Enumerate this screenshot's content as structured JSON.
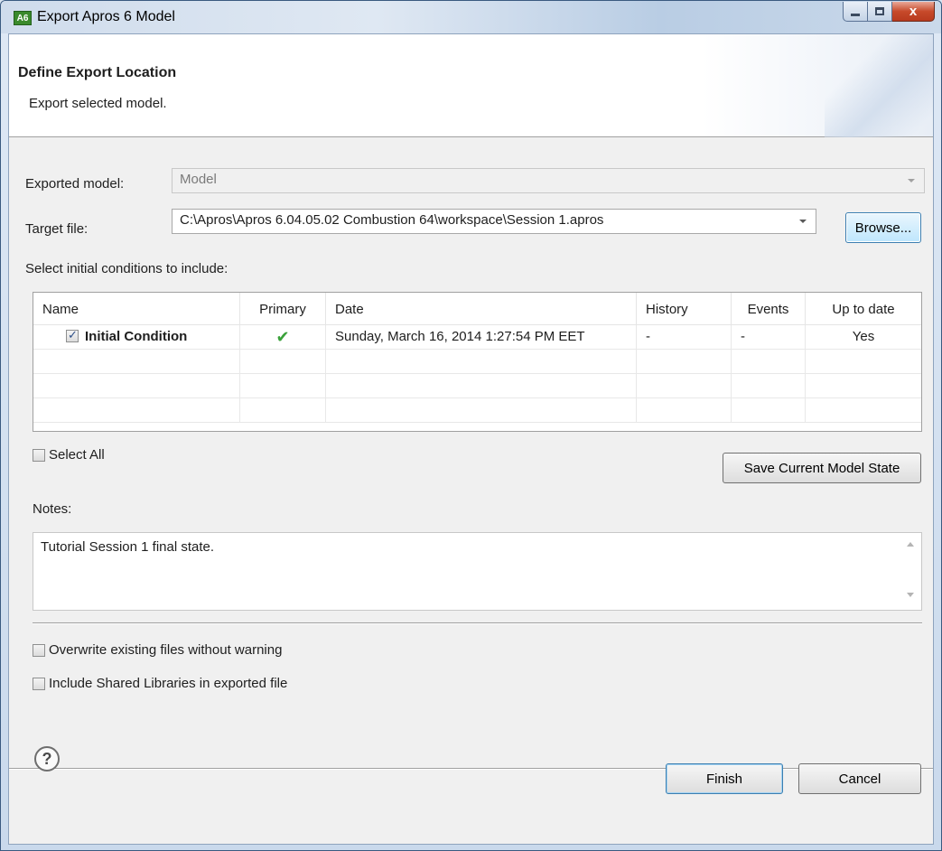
{
  "window": {
    "app_icon": "A6",
    "title": "Export Apros 6 Model",
    "close_glyph": "x"
  },
  "header": {
    "title": "Define Export Location",
    "subtitle": "Export selected model."
  },
  "form": {
    "model_label": "Exported model:",
    "model_value": "Model",
    "target_label": "Target file:",
    "target_value": "C:\\Apros\\Apros 6.04.05.02 Combustion 64\\workspace\\Session 1.apros",
    "browse_label": "Browse...",
    "ic_label": "Select initial conditions to include:"
  },
  "table": {
    "columns": [
      "Name",
      "Primary",
      "Date",
      "History",
      "Events",
      "Up to date"
    ],
    "rows": [
      {
        "checked": true,
        "name": "Initial Condition",
        "primary": "✔",
        "date": "Sunday, March 16, 2014 1:27:54 PM EET",
        "history": "-",
        "events": "-",
        "up_to_date": "Yes"
      }
    ]
  },
  "select_all_label": "Select All",
  "save_state_label": "Save Current Model State",
  "notes": {
    "label": "Notes:",
    "value": "Tutorial Session 1 final state."
  },
  "options": {
    "overwrite_label": "Overwrite existing files without warning",
    "include_libs_label": "Include Shared Libraries in exported file"
  },
  "footer": {
    "help_glyph": "?",
    "finish_label": "Finish",
    "cancel_label": "Cancel"
  }
}
